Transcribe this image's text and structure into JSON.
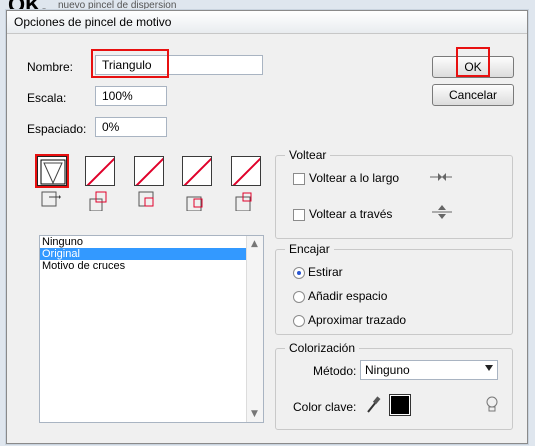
{
  "overlay": {
    "ok_text": "OK.",
    "background_text": "nuevo pincel de dispersion"
  },
  "dialog": {
    "title": "Opciones de pincel de motivo",
    "fields": {
      "nombre_label": "Nombre:",
      "nombre_value": "Triangulo",
      "escala_label": "Escala:",
      "escala_value": "100%",
      "espaciado_label": "Espaciado:",
      "espaciado_value": "0%"
    },
    "buttons": {
      "ok": "OK",
      "cancel": "Cancelar"
    },
    "tiles": [
      "side-tile",
      "outer-corner-tile",
      "inner-corner-tile",
      "start-tile",
      "end-tile"
    ],
    "patterns": {
      "items": [
        "Ninguno",
        "Original",
        "Motivo de cruces"
      ],
      "selected_index": 1
    },
    "voltear": {
      "legend": "Voltear",
      "along": {
        "label": "Voltear a lo largo",
        "checked": false
      },
      "across": {
        "label": "Voltear a través",
        "checked": false
      }
    },
    "encajar": {
      "legend": "Encajar",
      "options": [
        "Estirar",
        "Añadir espacio",
        "Aproximar trazado"
      ],
      "selected_index": 0
    },
    "colorizacion": {
      "legend": "Colorización",
      "metodo_label": "Método:",
      "metodo_value": "Ninguno",
      "color_clave_label": "Color clave:",
      "key_color": "#000000"
    },
    "accent": "#e81010"
  }
}
